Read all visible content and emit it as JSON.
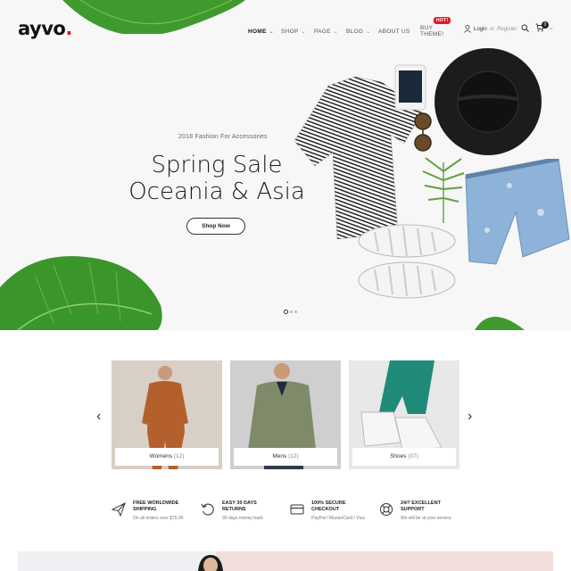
{
  "header": {
    "logo": "ayvo",
    "logo_dot": ".",
    "nav": [
      {
        "label": "HOME",
        "active": true,
        "has_dropdown": true
      },
      {
        "label": "SHOP",
        "active": false,
        "has_dropdown": true
      },
      {
        "label": "PAGE",
        "active": false,
        "has_dropdown": true
      },
      {
        "label": "BLOG",
        "active": false,
        "has_dropdown": true
      },
      {
        "label": "ABOUT US",
        "active": false,
        "has_dropdown": false
      },
      {
        "label": "BUY THEME!",
        "active": false,
        "has_dropdown": false
      }
    ],
    "hot_badge": "HOT!",
    "login_label": "Login",
    "or_label": "or",
    "register_label": "Register",
    "cart_count": "0",
    "accent_color": "#e0182d"
  },
  "hero": {
    "subtitle": "2018 Fashion For Accessories",
    "title_line1": "Spring Sale",
    "title_line2": "Oceania & Asia",
    "cta_label": "Shop Now",
    "slides": 3,
    "active_slide": 1
  },
  "categories": [
    {
      "name": "Womens",
      "count": "(12)"
    },
    {
      "name": "Mens",
      "count": "(12)"
    },
    {
      "name": "Shoes",
      "count": "(07)"
    }
  ],
  "features": [
    {
      "title_line1": "FREE WORLDWIDE",
      "title_line2": "SHIPPING",
      "desc": "On all orders over $75.00",
      "icon": "paper-plane-icon"
    },
    {
      "title_line1": "EASY 30 DAYS",
      "title_line2": "RETURNS",
      "desc": "30 days money back",
      "icon": "return-arrow-icon"
    },
    {
      "title_line1": "100% SECURE",
      "title_line2": "CHECKOUT",
      "desc": "PayPal / MasterCard / Visa",
      "icon": "credit-card-icon"
    },
    {
      "title_line1": "24/7 EXCELLENT",
      "title_line2": "SUPPORT",
      "desc": "We will be at your service",
      "icon": "lifebuoy-icon"
    }
  ]
}
